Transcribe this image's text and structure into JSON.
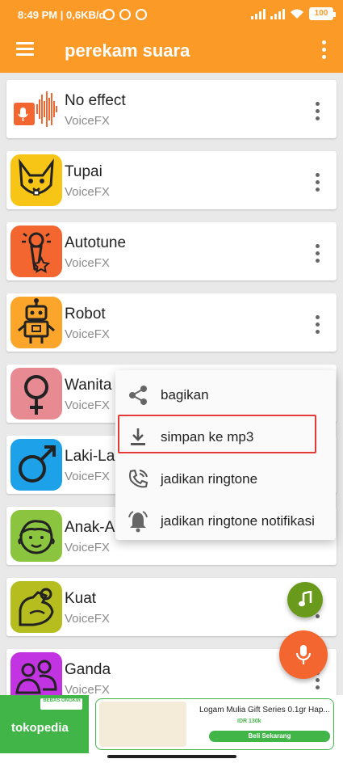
{
  "status_bar": {
    "time": "8:49 PM | 0,6KB/d",
    "battery": "100"
  },
  "app_bar": {
    "title": "perekam suara"
  },
  "list": [
    {
      "name": "No effect",
      "sub": "VoiceFX",
      "icon": "waveform-mic-icon"
    },
    {
      "name": "Tupai",
      "sub": "VoiceFX",
      "icon": "squirrel-icon"
    },
    {
      "name": "Autotune",
      "sub": "VoiceFX",
      "icon": "microphone-star-icon"
    },
    {
      "name": "Robot",
      "sub": "VoiceFX",
      "icon": "robot-icon"
    },
    {
      "name": "Wanita",
      "sub": "VoiceFX",
      "icon": "female-symbol-icon"
    },
    {
      "name": "Laki-La",
      "sub": "VoiceFX",
      "icon": "male-symbol-icon"
    },
    {
      "name": "Anak-A",
      "sub": "VoiceFX",
      "icon": "child-face-icon"
    },
    {
      "name": "Kuat",
      "sub": "VoiceFX",
      "icon": "strong-arm-icon"
    },
    {
      "name": "Ganda",
      "sub": "VoiceFX",
      "icon": "two-people-icon"
    }
  ],
  "context_menu": {
    "items": [
      {
        "label": "bagikan",
        "icon": "share-icon"
      },
      {
        "label": "simpan ke mp3",
        "icon": "download-icon"
      },
      {
        "label": "jadikan ringtone",
        "icon": "phone-ringing-icon"
      },
      {
        "label": "jadikan ringtone notifikasi",
        "icon": "bell-icon"
      }
    ],
    "highlighted_index": 1
  },
  "ad": {
    "brand": "tokopedia",
    "badge": "BEBAS ONGKIR",
    "product_title": "Logam Mulia Gift Series 0.1gr Hap...",
    "price": "IDR 130k",
    "cta": "Beli Sekarang"
  },
  "colors": {
    "primary": "#fb9a26",
    "fab_mic": "#f4662f",
    "fab_music": "#6a9a1c",
    "highlight": "#e53935",
    "tokopedia_green": "#42b549"
  }
}
